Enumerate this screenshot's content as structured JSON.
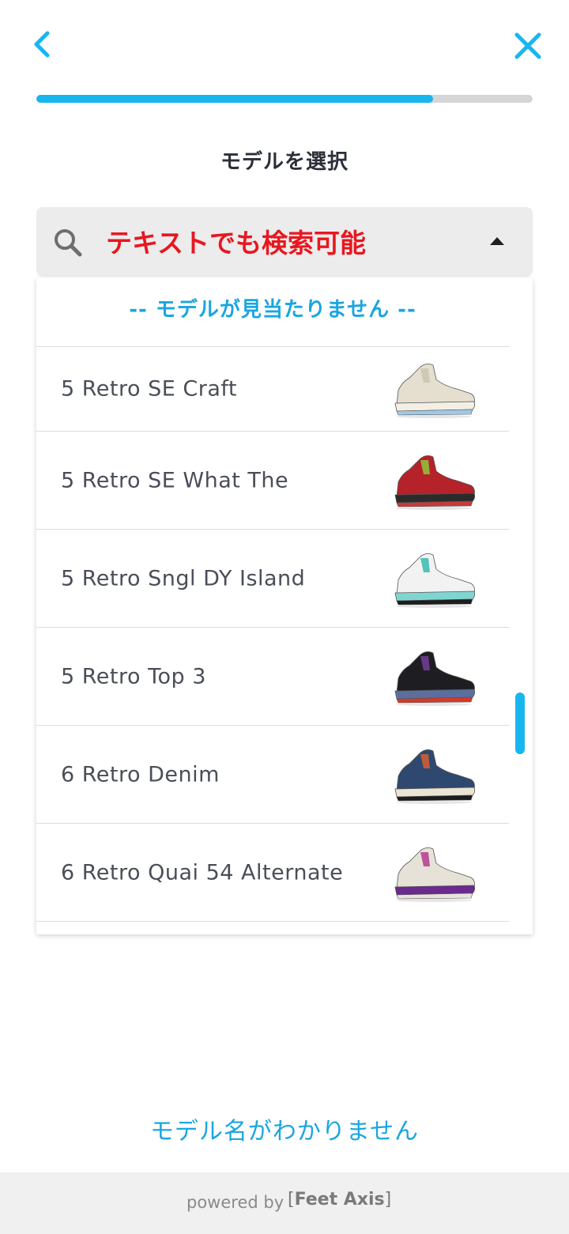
{
  "header": {
    "back_icon": "chevron-left-icon",
    "close_icon": "close-icon",
    "accent": "#18b6ef"
  },
  "progress": {
    "value": 0.8
  },
  "title": "モデルを選択",
  "search": {
    "placeholder": "テキストでも検索可能",
    "value": "",
    "icon": "search-icon",
    "toggle_icon": "caret-up-icon"
  },
  "dropdown": {
    "no_model_label": "-- モデルが見当たりません --",
    "items": [
      {
        "label": "5 Retro SE Craft",
        "image": "sneaker-cream"
      },
      {
        "label": "5 Retro SE What The",
        "image": "sneaker-red"
      },
      {
        "label": "5 Retro Sngl DY Island",
        "image": "sneaker-white-teal"
      },
      {
        "label": "5 Retro Top 3",
        "image": "sneaker-black-multi"
      },
      {
        "label": "6 Retro Denim",
        "image": "sneaker-denim"
      },
      {
        "label": "6 Retro Quai 54 Alternate",
        "image": "sneaker-white-purple"
      }
    ]
  },
  "unknown_model_link": "モデル名がわかりません",
  "footer": {
    "powered_by": "powered by",
    "brand": "Feet Axis"
  }
}
